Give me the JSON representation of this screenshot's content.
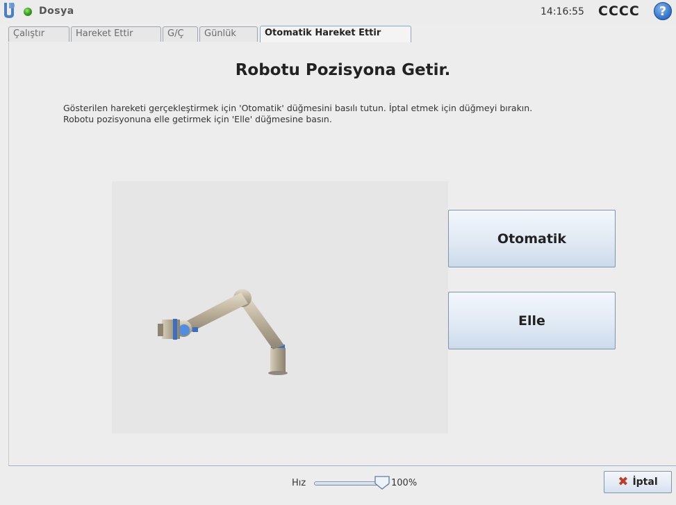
{
  "topbar": {
    "file_menu": "Dosya",
    "clock": "14:16:55",
    "robot_name": "CCCC",
    "help_glyph": "?",
    "status_color": "#3aa621"
  },
  "tabs": [
    {
      "label": "Çalıştır"
    },
    {
      "label": "Hareket Ettir"
    },
    {
      "label": "G/Ç"
    },
    {
      "label": "Günlük"
    },
    {
      "label": "Otomatik Hareket Ettir",
      "active": true
    }
  ],
  "main": {
    "title": "Robotu Pozisyona Getir.",
    "instructions": [
      "Gösterilen hareketi gerçekleştirmek için 'Otomatik' düğmesini basılı tutun. İptal etmek için düğmeyi bırakın.",
      "Robotu pozisyonuna elle getirmek için 'Elle' düğmesine basın."
    ],
    "auto_button": "Otomatik",
    "manual_button": "Elle"
  },
  "bottom": {
    "speed_label": "Hız",
    "speed_value": "100%",
    "speed_fraction": 1.0,
    "cancel_label": "İptal",
    "cancel_icon": "x-icon"
  },
  "colors": {
    "accent": "#8aa7c9",
    "cancel_icon": "#c0392b",
    "help_icon": "#3a78d0"
  }
}
